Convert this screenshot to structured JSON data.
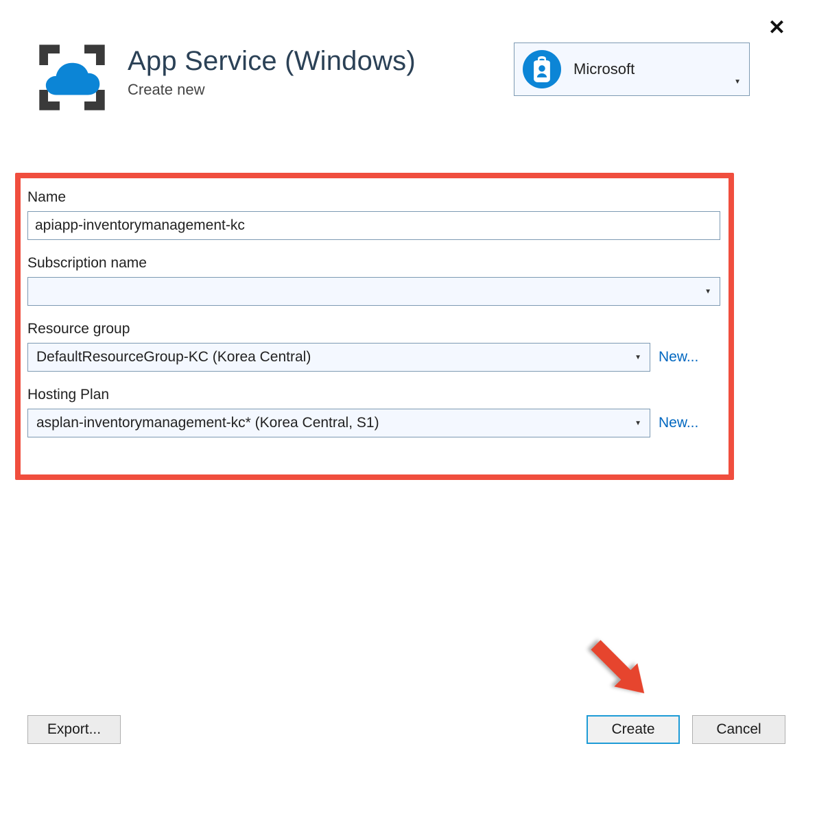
{
  "header": {
    "title": "App Service (Windows)",
    "subtitle": "Create new"
  },
  "account": {
    "name": "Microsoft"
  },
  "form": {
    "name_label": "Name",
    "name_value": "apiapp-inventorymanagement-kc",
    "subscription_label": "Subscription name",
    "subscription_value": "",
    "resource_group_label": "Resource group",
    "resource_group_value": "DefaultResourceGroup-KC (Korea Central)",
    "resource_group_new": "New...",
    "hosting_plan_label": "Hosting Plan",
    "hosting_plan_value": "asplan-inventorymanagement-kc* (Korea Central, S1)",
    "hosting_plan_new": "New..."
  },
  "footer": {
    "export": "Export...",
    "create": "Create",
    "cancel": "Cancel"
  }
}
